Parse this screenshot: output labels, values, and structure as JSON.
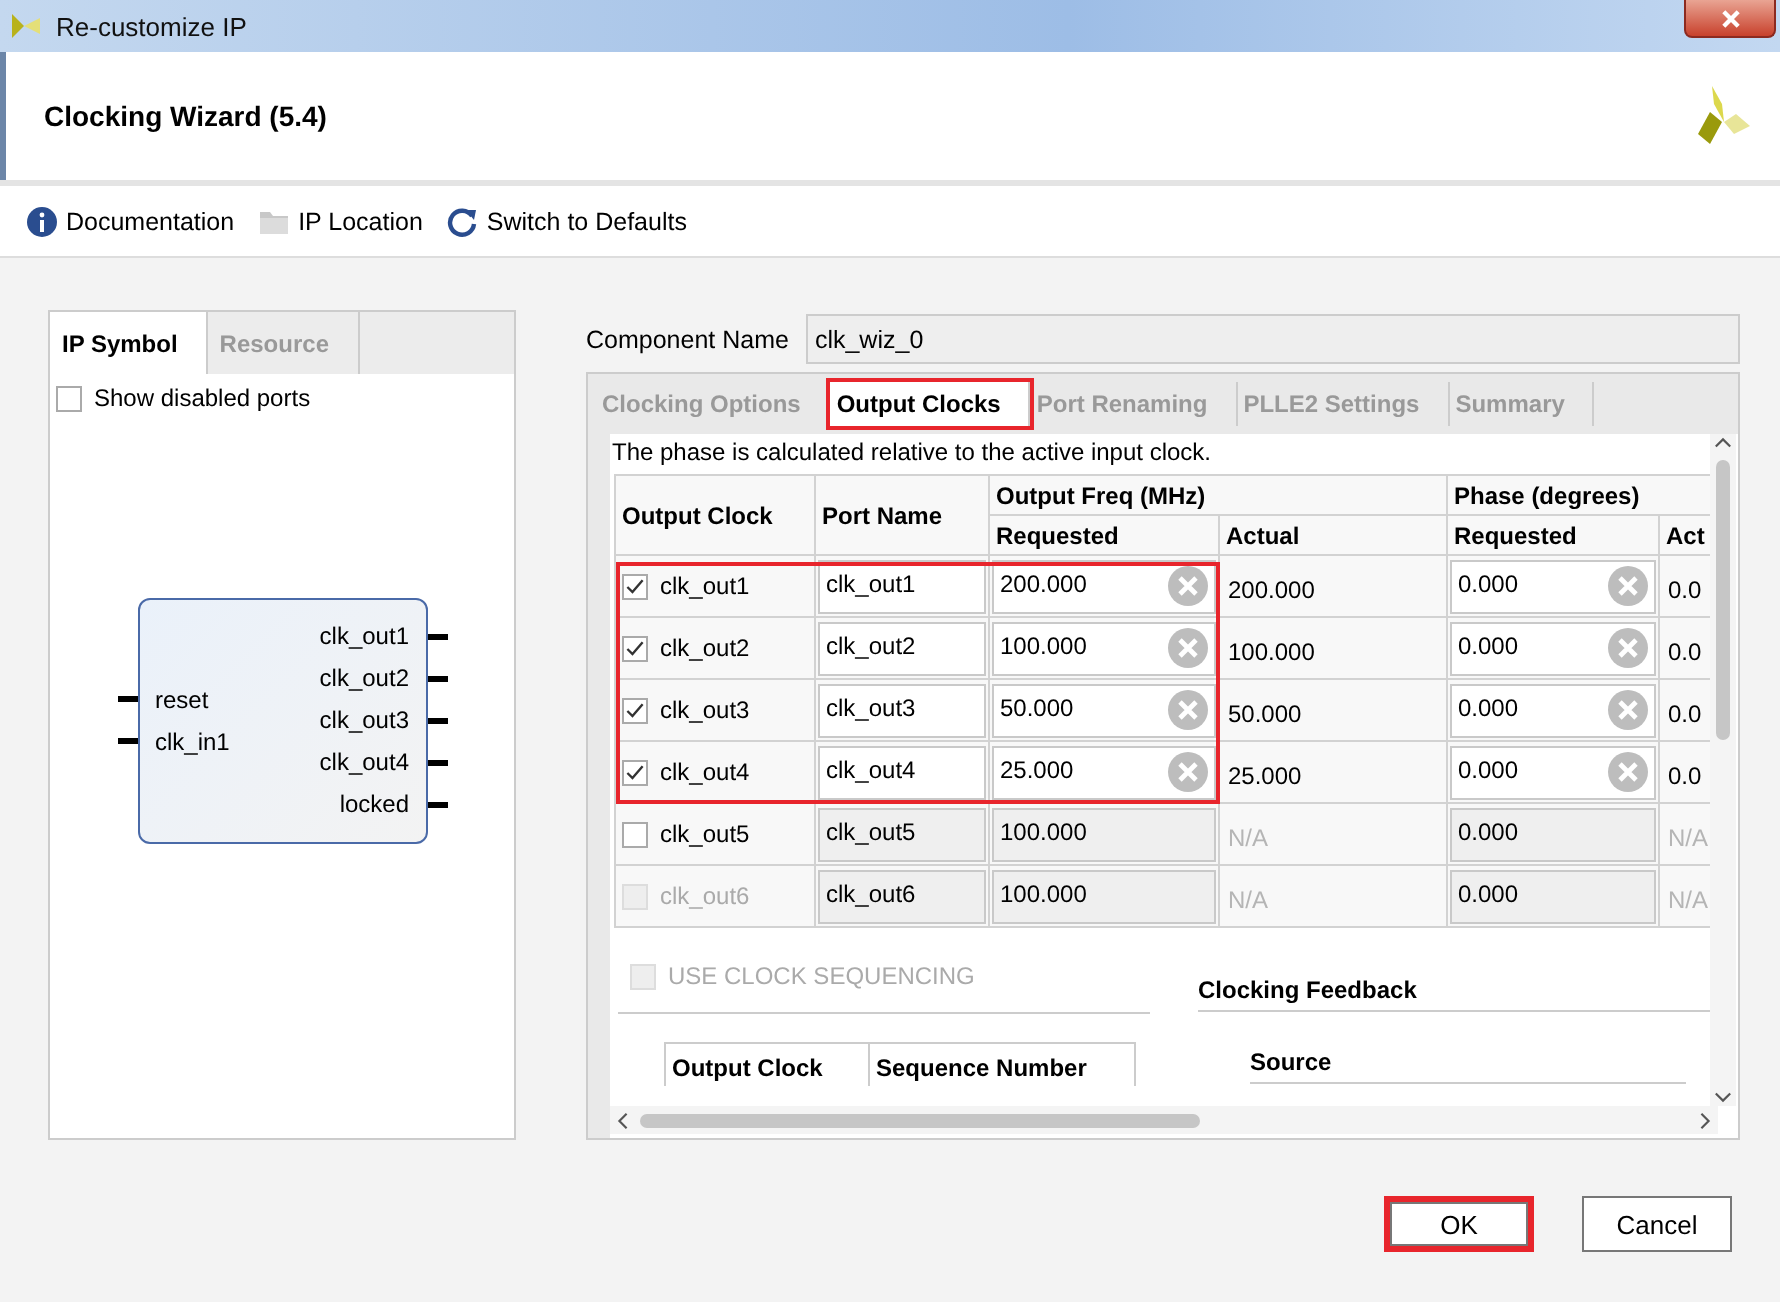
{
  "window": {
    "title": "Re-customize IP"
  },
  "header": {
    "title": "Clocking Wizard (5.4)"
  },
  "toolbar": [
    {
      "kind": "info",
      "label": "Documentation"
    },
    {
      "kind": "folder",
      "label": "IP Location"
    },
    {
      "kind": "refresh",
      "label": "Switch to Defaults"
    }
  ],
  "left_panel": {
    "tabs": [
      {
        "label": "IP Symbol",
        "selected": true
      },
      {
        "label": "Resource",
        "selected": false
      }
    ],
    "show_disabled_ports": {
      "label": "Show disabled ports",
      "checked": false
    },
    "symbol": {
      "inputs": [
        "reset",
        "clk_in1"
      ],
      "outputs": [
        "clk_out1",
        "clk_out2",
        "clk_out3",
        "clk_out4",
        "locked"
      ]
    }
  },
  "component_name": {
    "label": "Component Name",
    "value": "clk_wiz_0"
  },
  "tabs": [
    {
      "label": "Clocking Options",
      "selected": false,
      "highlighted": false
    },
    {
      "label": "Output Clocks",
      "selected": true,
      "highlighted": true
    },
    {
      "label": "Port Renaming",
      "selected": false,
      "highlighted": false
    },
    {
      "label": "PLLE2 Settings",
      "selected": false,
      "highlighted": false
    },
    {
      "label": "Summary",
      "selected": false,
      "highlighted": false
    }
  ],
  "note": "The phase is calculated relative to the active input clock.",
  "table": {
    "columns": {
      "output_clock": "Output Clock",
      "port_name": "Port Name",
      "freq_group": "Output Freq (MHz)",
      "freq_requested": "Requested",
      "freq_actual": "Actual",
      "phase_group": "Phase (degrees)",
      "phase_requested": "Requested",
      "column_7": "Act"
    },
    "rows": [
      {
        "name": "clk_out1",
        "checked": true,
        "disabled": false,
        "highlighted": true,
        "port": "clk_out1",
        "freq_requested": "200.000",
        "freq_actual": "200.000",
        "phase_requested": "0.000",
        "column_7": "0.0"
      },
      {
        "name": "clk_out2",
        "checked": true,
        "disabled": false,
        "highlighted": true,
        "port": "clk_out2",
        "freq_requested": "100.000",
        "freq_actual": "100.000",
        "phase_requested": "0.000",
        "column_7": "0.0"
      },
      {
        "name": "clk_out3",
        "checked": true,
        "disabled": false,
        "highlighted": true,
        "port": "clk_out3",
        "freq_requested": "50.000",
        "freq_actual": "50.000",
        "phase_requested": "0.000",
        "column_7": "0.0"
      },
      {
        "name": "clk_out4",
        "checked": true,
        "disabled": false,
        "highlighted": true,
        "port": "clk_out4",
        "freq_requested": "25.000",
        "freq_actual": "25.000",
        "phase_requested": "0.000",
        "column_7": "0.0"
      },
      {
        "name": "clk_out5",
        "checked": false,
        "disabled": false,
        "highlighted": false,
        "port": "clk_out5",
        "freq_requested": "100.000",
        "freq_actual": "N/A",
        "phase_requested": "0.000",
        "column_7": "N/A"
      },
      {
        "name": "clk_out6",
        "checked": false,
        "disabled": true,
        "highlighted": false,
        "port": "clk_out6",
        "freq_requested": "100.000",
        "freq_actual": "N/A",
        "phase_requested": "0.000",
        "column_7": "N/A"
      }
    ]
  },
  "sequencing": {
    "label": "USE CLOCK SEQUENCING",
    "checked": false,
    "disabled": true,
    "columns": [
      "Output Clock",
      "Sequence Number"
    ]
  },
  "feedback": {
    "title": "Clocking Feedback",
    "source": "Source"
  },
  "buttons": [
    {
      "label": "OK",
      "highlighted": true
    },
    {
      "label": "Cancel",
      "highlighted": false
    }
  ]
}
